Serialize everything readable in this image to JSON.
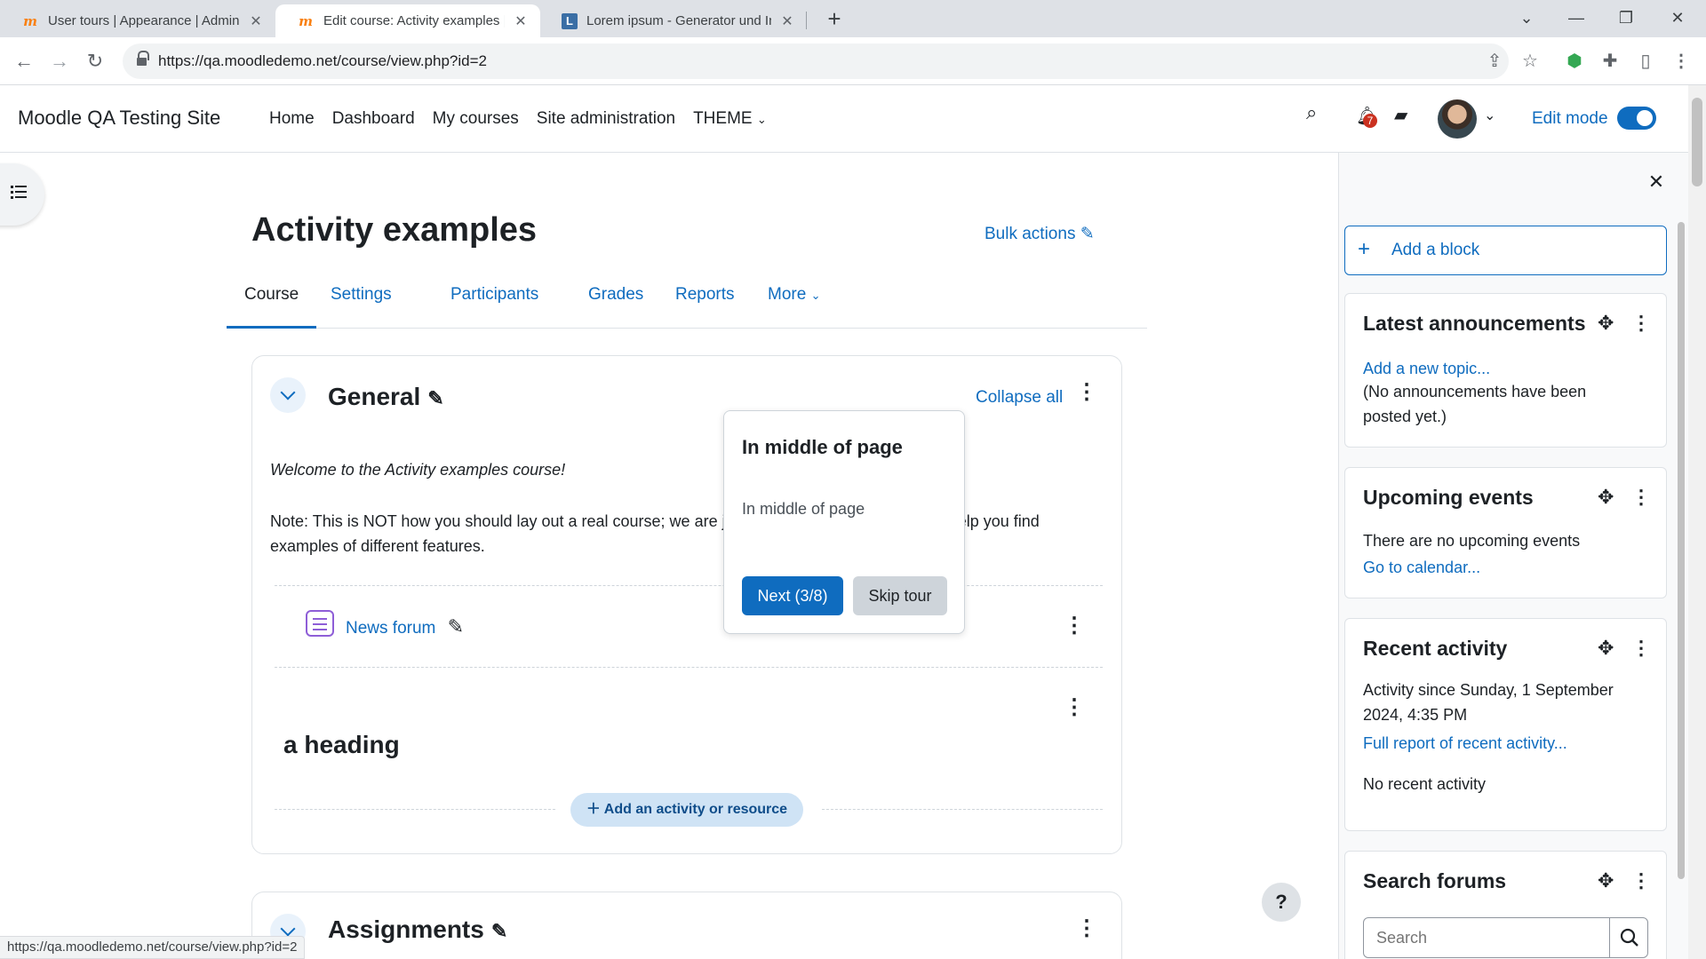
{
  "browser": {
    "tabs": [
      {
        "title": "User tours | Appearance | Administ",
        "favicon": "moodle-icon"
      },
      {
        "title": "Edit course: Activity examples | M",
        "favicon": "moodle-icon",
        "active": true
      },
      {
        "title": "Lorem ipsum - Generator und Infos",
        "favicon": "lorem-icon"
      }
    ],
    "url": "https://qa.moodledemo.net/course/view.php?id=2",
    "status_url": "https://qa.moodledemo.net/course/view.php?id=2"
  },
  "navbar": {
    "site_name": "Moodle QA Testing Site",
    "links": [
      "Home",
      "Dashboard",
      "My courses",
      "Site administration",
      "THEME"
    ],
    "notification_count": "7",
    "edit_mode_label": "Edit mode",
    "edit_mode_on": true
  },
  "course": {
    "title": "Activity examples",
    "bulk_actions": "Bulk actions",
    "tabs": [
      "Course",
      "Settings",
      "Participants",
      "Grades",
      "Reports",
      "More"
    ],
    "active_tab": "Course"
  },
  "sections": {
    "general": {
      "title": "General",
      "collapse_all": "Collapse all",
      "welcome": "Welcome to the Activity examples course!",
      "note": "Note: This is NOT how you should lay out a real course; we are just doing it like this here just to help you find examples of different features.",
      "forum_name": "News forum",
      "heading": "a heading",
      "add_activity": "Add an activity or resource"
    },
    "assignments": {
      "title": "Assignments"
    }
  },
  "tour": {
    "title": "In middle of page",
    "body": "In middle of page",
    "next_label": "Next (3/8)",
    "skip_label": "Skip tour"
  },
  "blocks": {
    "add_block": "Add a block",
    "latest_announcements": {
      "title": "Latest announcements",
      "link": "Add a new topic...",
      "text": "(No announcements have been posted yet.)"
    },
    "upcoming_events": {
      "title": "Upcoming events",
      "text": "There are no upcoming events",
      "link": "Go to calendar..."
    },
    "recent_activity": {
      "title": "Recent activity",
      "since": "Activity since Sunday, 1 September 2024, 4:35 PM",
      "link": "Full report of recent activity...",
      "empty": "No recent activity"
    },
    "search_forums": {
      "title": "Search forums",
      "placeholder": "Search"
    }
  },
  "colors": {
    "primary": "#0f6cbf",
    "forum_purple": "#8e5ed7",
    "badge_red": "#ca3120"
  }
}
